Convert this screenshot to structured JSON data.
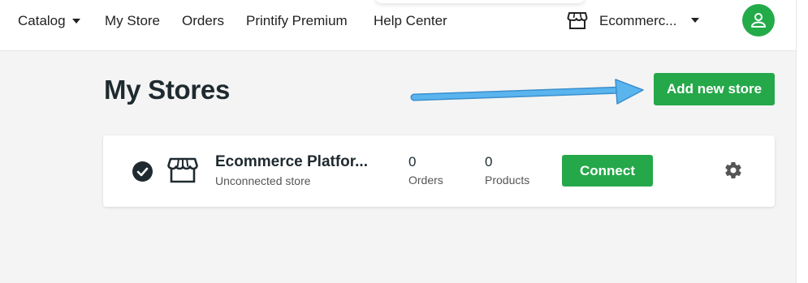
{
  "nav": {
    "catalog": "Catalog",
    "my_store": "My Store",
    "orders": "Orders",
    "premium": "Printify Premium",
    "help": "Help Center"
  },
  "store_switcher": {
    "name": "Ecommerc...",
    "icon": "storefront-icon"
  },
  "user": {
    "icon": "user-icon"
  },
  "page": {
    "title": "My Stores",
    "add_button": "Add new store"
  },
  "store": {
    "name": "Ecommerce Platfor...",
    "status": "Unconnected store",
    "orders_count": "0",
    "orders_label": "Orders",
    "products_count": "0",
    "products_label": "Products",
    "connect_label": "Connect",
    "icons": [
      "check-circle-icon",
      "storefront-icon",
      "gear-icon"
    ]
  },
  "colors": {
    "brand_green": "#25a84a",
    "annotation_arrow": "#4aa9e6",
    "text_dark": "#1f2a30",
    "background": "#f4f4f4"
  }
}
